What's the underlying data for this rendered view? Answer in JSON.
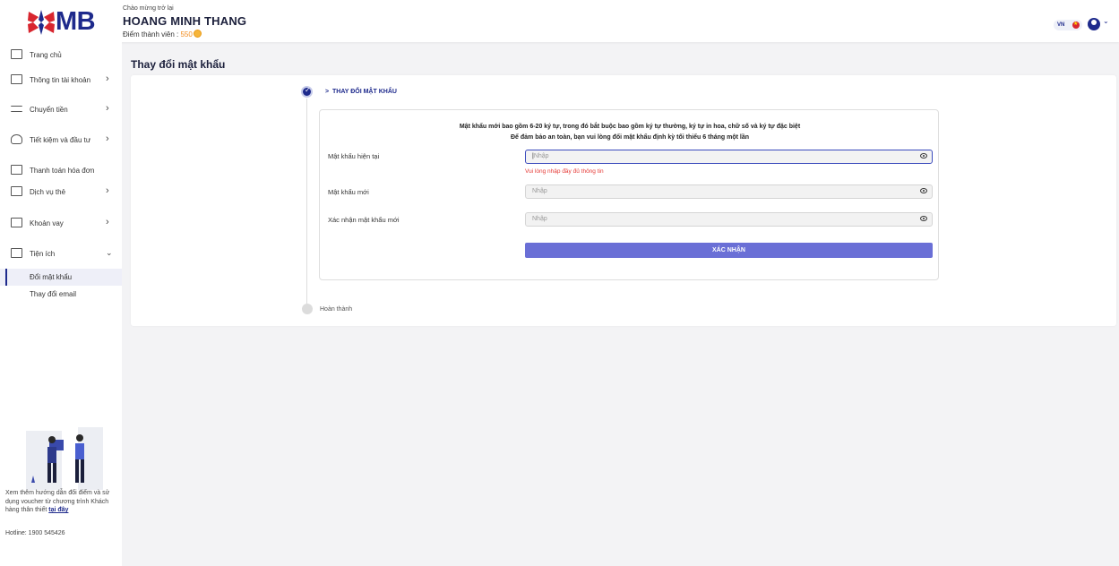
{
  "header": {
    "logo_text": "MB",
    "greeting": "Chào mừng trở lại",
    "user_name": "HOANG MINH THANG",
    "points_label": "Điểm thành viên : ",
    "points_value": "550",
    "lang": "VN"
  },
  "sidebar": {
    "items": [
      {
        "label": "Trang chủ"
      },
      {
        "label": "Thông tin tài khoản"
      },
      {
        "label": "Chuyển tiền"
      },
      {
        "label": "Tiết kiệm và đầu tư"
      },
      {
        "label": "Thanh toán hóa đơn"
      },
      {
        "label": "Dịch vụ thẻ"
      },
      {
        "label": "Khoản vay"
      },
      {
        "label": "Tiện ích"
      }
    ],
    "sub_items": [
      {
        "label": "Đổi mật khẩu"
      },
      {
        "label": "Thay đổi email"
      }
    ],
    "promo_text": "Xem thêm hướng dẫn đổi điểm và sử dụng voucher từ chương trình Khách hàng thân thiết ",
    "promo_link": "tại đây",
    "hotline": "Hotline: 1900 545426"
  },
  "main": {
    "title": "Thay đổi mật khẩu",
    "step1_label": "THAY ĐỔI MẬT KHẨU",
    "step2_label": "Hoàn thành",
    "rule1": "Mật khẩu mới bao gồm 6-20 ký tự, trong đó bắt buộc bao gồm ký tự thường, ký tự in hoa, chữ số và ký tự đặc biệt",
    "rule2": "Để đảm bảo an toàn, bạn vui lòng đổi mật khẩu định kỳ tối thiểu 6 tháng một lần",
    "fields": [
      {
        "label": "Mật khẩu hiện tại",
        "placeholder": "Nhập"
      },
      {
        "label": "Mật khẩu mới",
        "placeholder": "Nhập"
      },
      {
        "label": "Xác nhận mật khẩu mới",
        "placeholder": "Nhập"
      }
    ],
    "error": "Vui lòng nhập đầy đủ thông tin",
    "submit": "XÁC NHẬN"
  },
  "colors": {
    "brand": "#1e2a8c",
    "button": "#6a6fd6",
    "error": "#e53935",
    "points": "#f28b1d"
  }
}
